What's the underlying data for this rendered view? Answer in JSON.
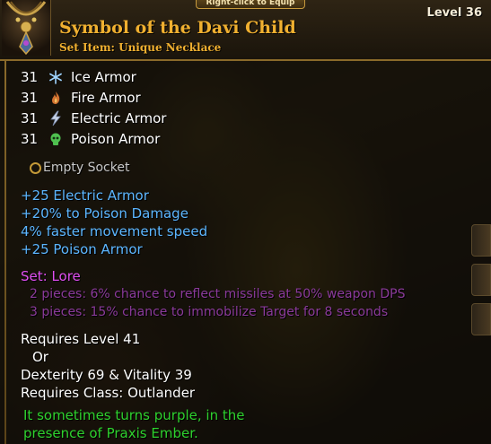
{
  "equip_hint": "Right-click to Equip",
  "item": {
    "name": "Symbol of the Davi Child",
    "type": "Set Item: Unique Necklace",
    "level_label": "Level 36"
  },
  "armor": [
    {
      "value": "31",
      "label": "Ice Armor",
      "icon": "snowflake-icon"
    },
    {
      "value": "31",
      "label": "Fire Armor",
      "icon": "flame-icon"
    },
    {
      "value": "31",
      "label": "Electric Armor",
      "icon": "lightning-icon"
    },
    {
      "value": "31",
      "label": "Poison Armor",
      "icon": "poison-skull-icon"
    }
  ],
  "socket": {
    "label": "Empty Socket"
  },
  "magic_properties": [
    "+25 Electric Armor",
    "+20% to Poison Damage",
    "4% faster movement speed",
    "+25 Poison Armor"
  ],
  "set": {
    "name": "Set: Lore",
    "pieces": [
      "2 pieces: 6% chance to reflect missiles at 50% weapon DPS",
      "3 pieces: 15% chance to immobilize Target for 8 seconds"
    ]
  },
  "requirements": {
    "level": "Requires Level 41",
    "or": "Or",
    "stats": "Dexterity 69 & Vitality 39",
    "class": "Requires Class: Outlander"
  },
  "flavor": [
    "It sometimes turns purple, in the",
    "presence of Praxis Ember."
  ],
  "colors": {
    "title": "#f0b030",
    "magic": "#5cb6ff",
    "set_name": "#e050f0",
    "set_piece": "#8a3a9a",
    "flavor": "#2ed12e"
  }
}
